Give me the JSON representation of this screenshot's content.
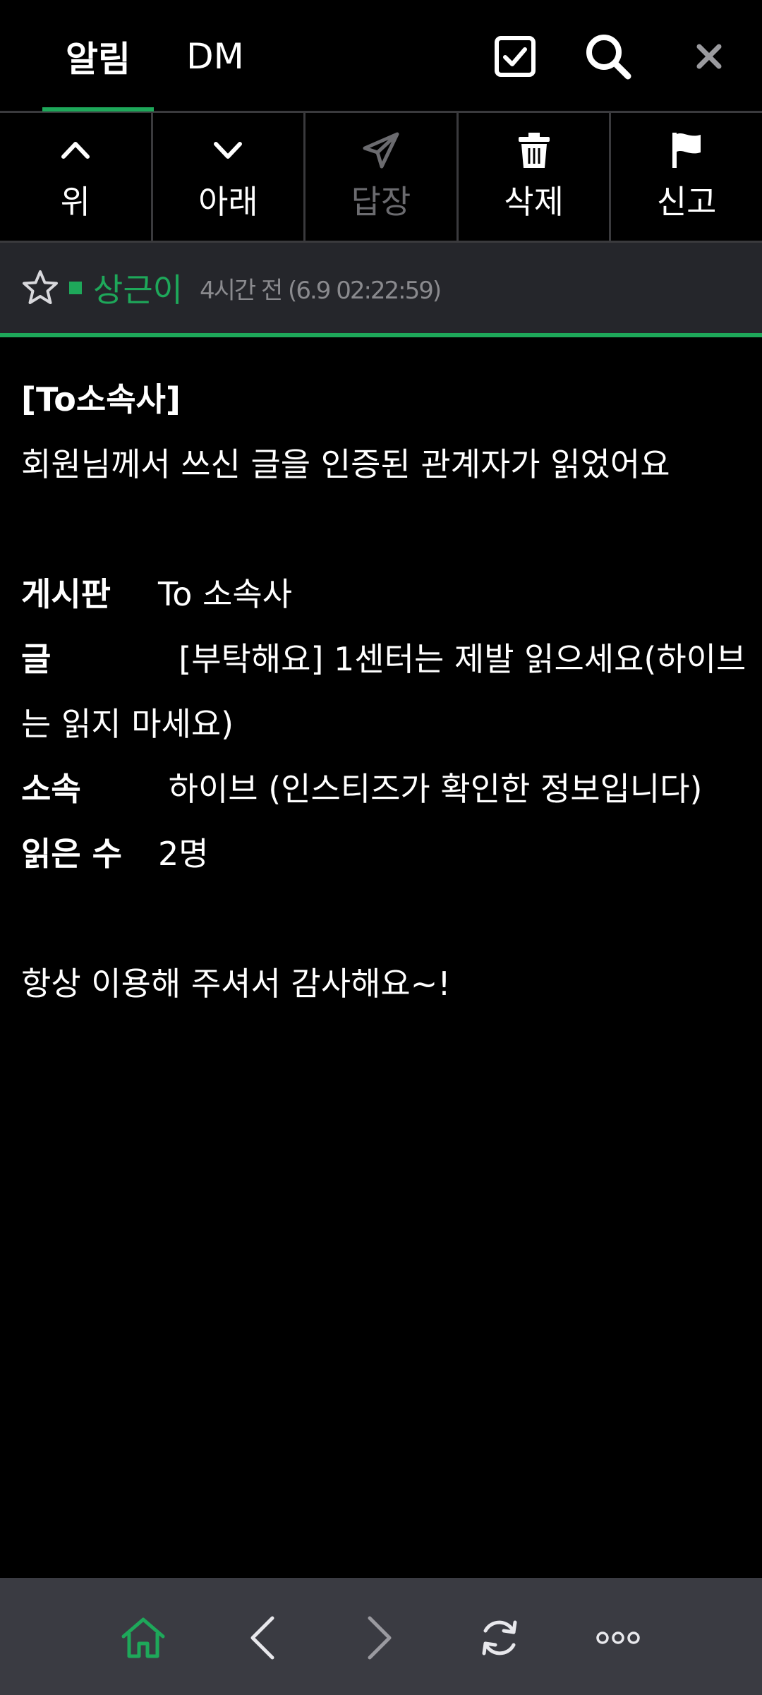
{
  "header": {
    "tabs": [
      {
        "label": "알림",
        "active": true
      },
      {
        "label": "DM",
        "active": false
      }
    ],
    "icons": [
      "checkbox-icon",
      "search-icon",
      "close-icon"
    ]
  },
  "toolbar": {
    "buttons": [
      {
        "label": "위",
        "icon": "chevron-up-icon",
        "enabled": true
      },
      {
        "label": "아래",
        "icon": "chevron-down-icon",
        "enabled": true
      },
      {
        "label": "답장",
        "icon": "send-icon",
        "enabled": false
      },
      {
        "label": "삭제",
        "icon": "trash-icon",
        "enabled": true
      },
      {
        "label": "신고",
        "icon": "flag-icon",
        "enabled": true
      }
    ]
  },
  "sender": {
    "name": "상근이",
    "time": "4시간 전 (6.9 02:22:59)"
  },
  "message": {
    "title": "[To소속사]",
    "intro": "회원님께서 쓰신 글을 인증된 관계자가 읽었어요",
    "fields": [
      {
        "label": "게시판",
        "value": "To 소속사"
      },
      {
        "label": "글",
        "value": "  [부탁해요] 1센터는 제발 읽으세요(하이브",
        "cont": "는 읽지 마세요)"
      },
      {
        "label": "소속",
        "value": " 하이브 (인스티즈가 확인한 정보입니다)"
      },
      {
        "label": "읽은 수",
        "value": "2명"
      }
    ],
    "outro": "항상 이용해 주셔서 감사해요~!"
  },
  "colors": {
    "accent": "#1ea85a",
    "background": "#000000",
    "bar": "#25262b",
    "nav": "#3a3b42"
  },
  "bottom_nav": [
    "home-icon",
    "back-icon",
    "forward-icon",
    "refresh-icon",
    "more-icon"
  ]
}
